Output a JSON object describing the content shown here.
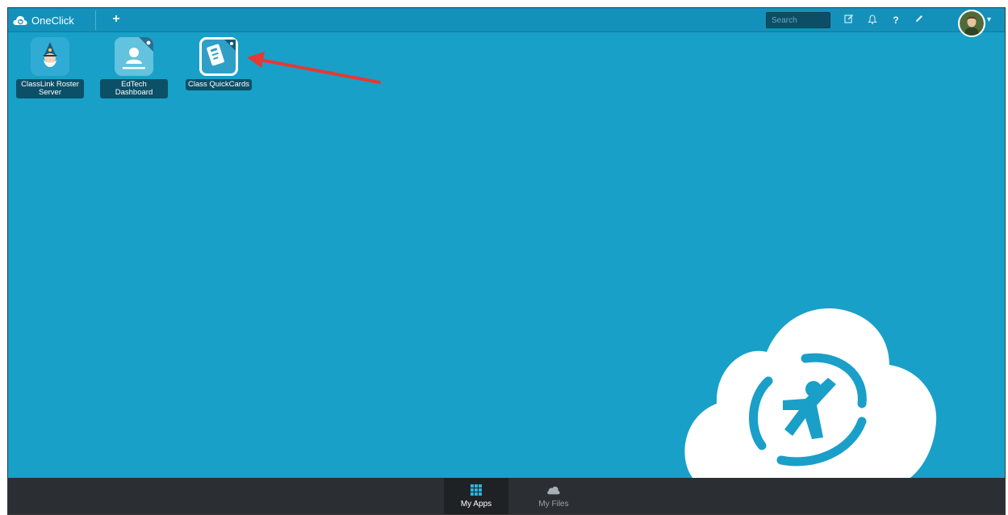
{
  "topbar": {
    "brand": "OneClick",
    "add_icon": "plus-icon",
    "search_placeholder": "Search",
    "icons": [
      "edit-icon",
      "bell-icon",
      "help-icon",
      "pencil-icon"
    ],
    "help_glyph": "?"
  },
  "apps": [
    {
      "label": "ClassLink Roster Server",
      "icon": "wizard-icon"
    },
    {
      "label": "EdTech Dashboard",
      "icon": "user-card-icon"
    },
    {
      "label": "Class QuickCards",
      "icon": "quickcards-icon"
    }
  ],
  "bottom_nav": {
    "items": [
      {
        "label": "My Apps",
        "icon": "grid-icon",
        "active": true
      },
      {
        "label": "My Files",
        "icon": "cloud-icon",
        "active": false
      }
    ]
  },
  "colors": {
    "background": "#18a0c8",
    "topbar": "#1491ba",
    "bottombar": "#2b2f33",
    "label_bg": "#0c5068",
    "annotation_arrow": "#e53935"
  }
}
